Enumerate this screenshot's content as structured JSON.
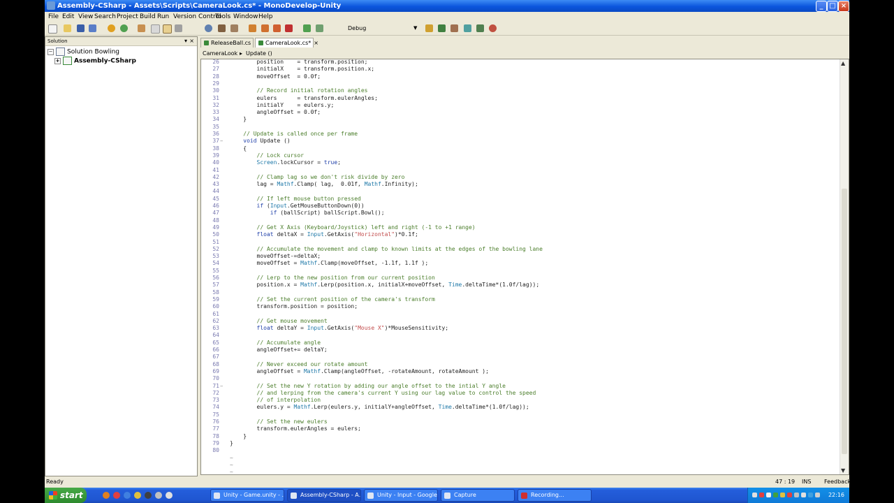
{
  "window": {
    "title": "Assembly-CSharp - Assets\\Scripts\\CameraLook.cs* - MonoDevelop-Unity",
    "min": "_",
    "max": "□",
    "close": "×"
  },
  "menu": [
    {
      "label": "File"
    },
    {
      "label": "Edit"
    },
    {
      "label": "View"
    },
    {
      "label": "Search"
    },
    {
      "label": "Project"
    },
    {
      "label": "Build"
    },
    {
      "label": "Run"
    },
    {
      "label": "Version Control"
    },
    {
      "label": "Tools"
    },
    {
      "label": "Window"
    },
    {
      "label": "Help"
    }
  ],
  "toolbar": {
    "config": "Debug",
    "config_arrow": "▼"
  },
  "solution": {
    "header": "Solution",
    "pin": "▾",
    "close": "×",
    "root": "Solution Bowling",
    "root_expander": "−",
    "project": "Assembly-CSharp",
    "project_expander": "+"
  },
  "tabs": [
    {
      "label": "ReleaseBall.cs",
      "close": "×"
    },
    {
      "label": "CameraLook.cs*",
      "close": "×"
    }
  ],
  "breadcrumb": {
    "class_name": "CameraLook",
    "sep": "▸",
    "method": "Update ()"
  },
  "code": {
    "lines": [
      {
        "n": "26",
        "text": "        position    = transform.position;"
      },
      {
        "n": "27",
        "text": "        initialX    = transform.position.x;"
      },
      {
        "n": "28",
        "text": "        moveOffset  = 0.0f;"
      },
      {
        "n": "29",
        "text": ""
      },
      {
        "n": "30",
        "text": "        // Record initial rotation angles"
      },
      {
        "n": "31",
        "text": "        eulers      = transform.eulerAngles;"
      },
      {
        "n": "32",
        "text": "        initialY    = eulers.y;"
      },
      {
        "n": "33",
        "text": "        angleOffset = 0.0f;"
      },
      {
        "n": "34",
        "text": "    }"
      },
      {
        "n": "35",
        "text": ""
      },
      {
        "n": "36",
        "text": "    // Update is called once per frame"
      },
      {
        "n": "37",
        "text": "    void Update ()",
        "fold": "−"
      },
      {
        "n": "38",
        "text": "    {"
      },
      {
        "n": "39",
        "text": "        // Lock cursor"
      },
      {
        "n": "40",
        "text": "        Screen.lockCursor = true;"
      },
      {
        "n": "41",
        "text": ""
      },
      {
        "n": "42",
        "text": "        // Clamp lag so we don't risk divide by zero"
      },
      {
        "n": "43",
        "text": "        lag = Mathf.Clamp( lag,  0.01f, Mathf.Infinity);"
      },
      {
        "n": "44",
        "text": ""
      },
      {
        "n": "45",
        "text": "        // If left mouse button pressed"
      },
      {
        "n": "46",
        "text": "        if (Input.GetMouseButtonDown(0))"
      },
      {
        "n": "47",
        "text": "            if (ballScript) ballScript.Bowl();"
      },
      {
        "n": "48",
        "text": ""
      },
      {
        "n": "49",
        "text": "        // Get X Axis (Keyboard/Joystick) left and right (-1 to +1 range)"
      },
      {
        "n": "50",
        "text": "        float deltaX = Input.GetAxis(\"Horizontal\")*0.1f;"
      },
      {
        "n": "51",
        "text": ""
      },
      {
        "n": "52",
        "text": "        // Accumulate the movement and clamp to known limits at the edges of the bowling lane"
      },
      {
        "n": "53",
        "text": "        moveOffset-=deltaX;"
      },
      {
        "n": "54",
        "text": "        moveOffset = Mathf.Clamp(moveOffset, -1.1f, 1.1f );"
      },
      {
        "n": "55",
        "text": ""
      },
      {
        "n": "56",
        "text": "        // Lerp to the new position from our current position"
      },
      {
        "n": "57",
        "text": "        position.x = Mathf.Lerp(position.x, initialX+moveOffset, Time.deltaTime*(1.0f/lag));"
      },
      {
        "n": "58",
        "text": ""
      },
      {
        "n": "59",
        "text": "        // Set the current position of the camera's transform"
      },
      {
        "n": "60",
        "text": "        transform.position = position;"
      },
      {
        "n": "61",
        "text": ""
      },
      {
        "n": "62",
        "text": "        // Get mouse movement"
      },
      {
        "n": "63",
        "text": "        float deltaY = Input.GetAxis(\"Mouse X\")*MouseSensitivity;"
      },
      {
        "n": "64",
        "text": ""
      },
      {
        "n": "65",
        "text": "        // Accumulate angle"
      },
      {
        "n": "66",
        "text": "        angleOffset+= deltaY;"
      },
      {
        "n": "67",
        "text": ""
      },
      {
        "n": "68",
        "text": "        // Never exceed our rotate amount"
      },
      {
        "n": "69",
        "text": "        angleOffset = Mathf.Clamp(angleOffset, -rotateAmount, rotateAmount );"
      },
      {
        "n": "70",
        "text": ""
      },
      {
        "n": "71",
        "text": "        // Set the new Y rotation by adding our angle offset to the intial Y angle",
        "fold": "−"
      },
      {
        "n": "72",
        "text": "        // and lerping from the camera's current Y using our lag value to control the speed"
      },
      {
        "n": "73",
        "text": "        // of interpolation"
      },
      {
        "n": "74",
        "text": "        eulers.y = Mathf.Lerp(eulers.y, initialY+angleOffset, Time.deltaTime*(1.0f/lag));"
      },
      {
        "n": "75",
        "text": ""
      },
      {
        "n": "76",
        "text": "        // Set the new eulers"
      },
      {
        "n": "77",
        "text": "        transform.eulerAngles = eulers;"
      },
      {
        "n": "78",
        "text": "    }"
      },
      {
        "n": "79",
        "text": "}"
      },
      {
        "n": "80",
        "text": ""
      },
      {
        "n": "",
        "text": "~"
      },
      {
        "n": "",
        "text": "~"
      },
      {
        "n": "",
        "text": "~"
      }
    ]
  },
  "scrollbar": {
    "up": "▲",
    "down": "▼"
  },
  "status": {
    "text": "Ready",
    "position": "47 : 19",
    "mode": "INS",
    "feedback": "Feedback"
  },
  "taskbar": {
    "start": "start",
    "tasks": [
      {
        "label": "Unity - Game.unity - ..."
      },
      {
        "label": "Assembly-CSharp - A..."
      },
      {
        "label": "Unity - Input - Google..."
      },
      {
        "label": "Capture"
      },
      {
        "label": "Recording..."
      }
    ],
    "clock": "22:16"
  }
}
